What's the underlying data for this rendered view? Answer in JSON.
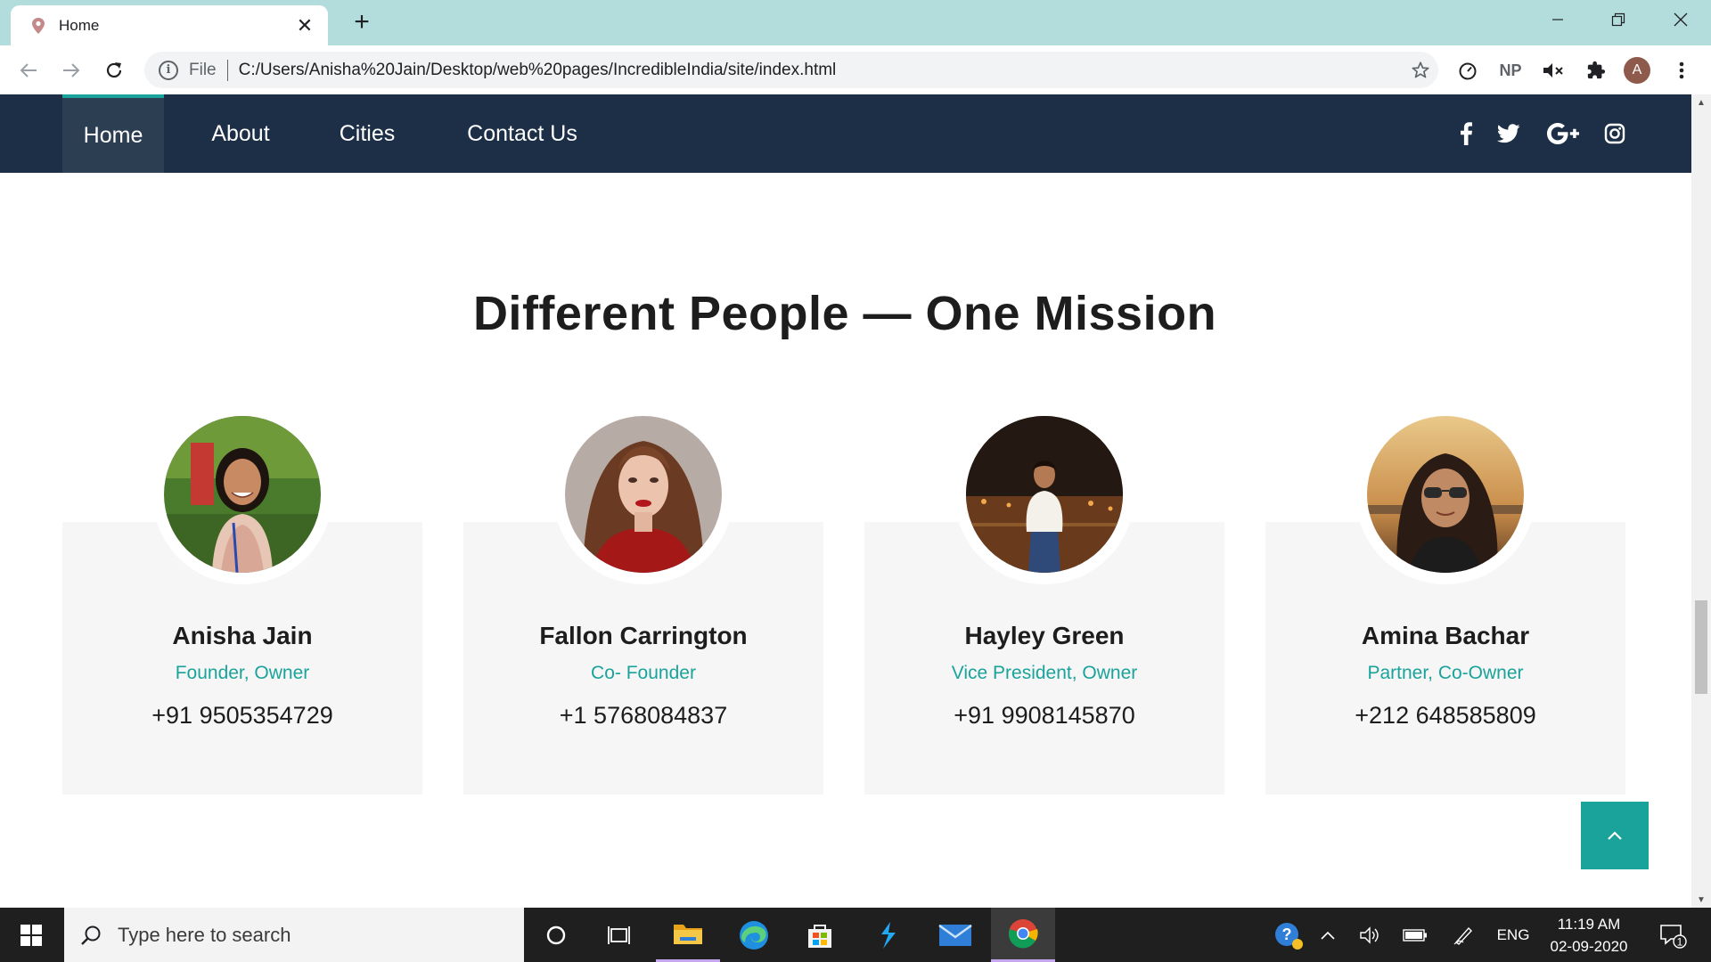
{
  "browser": {
    "tab_title": "Home",
    "url_scheme": "File",
    "url": "C:/Users/Anisha%20Jain/Desktop/web%20pages/IncredibleIndia/site/index.html",
    "extension_np": "NP",
    "profile_initial": "A"
  },
  "site": {
    "nav": [
      "Home",
      "About",
      "Cities",
      "Contact Us"
    ],
    "active_nav": "Home",
    "social_icons": [
      "facebook-icon",
      "twitter-icon",
      "google-plus-icon",
      "instagram-icon"
    ],
    "heading": "Different People — One Mission",
    "team": [
      {
        "name": "Anisha Jain",
        "role": "Founder, Owner",
        "phone": "+91 9505354729"
      },
      {
        "name": "Fallon Carrington",
        "role": "Co- Founder",
        "phone": "+1 5768084837"
      },
      {
        "name": "Hayley Green",
        "role": "Vice President, Owner",
        "phone": "+91 9908145870"
      },
      {
        "name": "Amina Bachar",
        "role": "Partner, Co-Owner",
        "phone": "+212 648585809"
      }
    ],
    "colors": {
      "nav_bg": "#1c2f47",
      "accent": "#1aa39a",
      "card_bg": "#f6f6f6"
    }
  },
  "taskbar": {
    "search_placeholder": "Type here to search",
    "language": "ENG",
    "time": "11:19 AM",
    "date": "02-09-2020",
    "notification_count": "1"
  }
}
